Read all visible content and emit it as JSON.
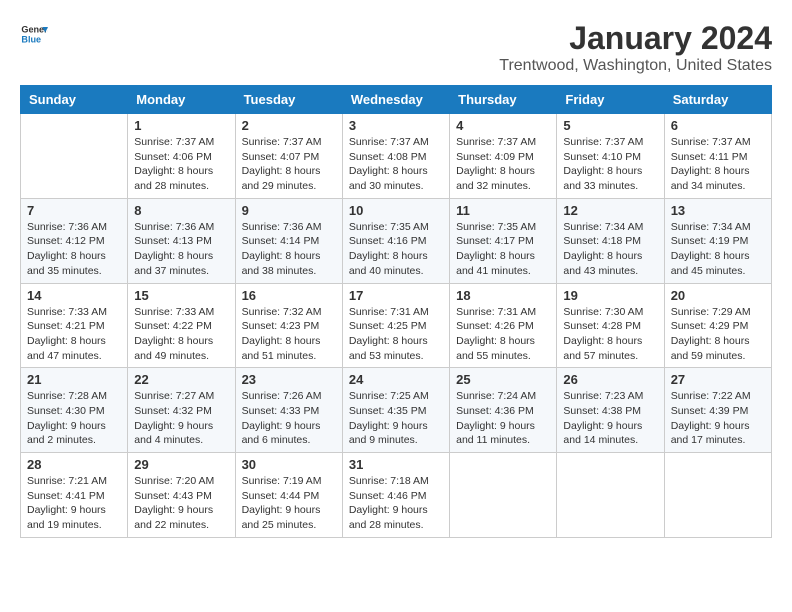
{
  "logo": {
    "general": "General",
    "blue": "Blue"
  },
  "title": "January 2024",
  "location": "Trentwood, Washington, United States",
  "days_of_week": [
    "Sunday",
    "Monday",
    "Tuesday",
    "Wednesday",
    "Thursday",
    "Friday",
    "Saturday"
  ],
  "weeks": [
    [
      {
        "day": "",
        "sunrise": "",
        "sunset": "",
        "daylight": ""
      },
      {
        "day": "1",
        "sunrise": "Sunrise: 7:37 AM",
        "sunset": "Sunset: 4:06 PM",
        "daylight": "Daylight: 8 hours and 28 minutes."
      },
      {
        "day": "2",
        "sunrise": "Sunrise: 7:37 AM",
        "sunset": "Sunset: 4:07 PM",
        "daylight": "Daylight: 8 hours and 29 minutes."
      },
      {
        "day": "3",
        "sunrise": "Sunrise: 7:37 AM",
        "sunset": "Sunset: 4:08 PM",
        "daylight": "Daylight: 8 hours and 30 minutes."
      },
      {
        "day": "4",
        "sunrise": "Sunrise: 7:37 AM",
        "sunset": "Sunset: 4:09 PM",
        "daylight": "Daylight: 8 hours and 32 minutes."
      },
      {
        "day": "5",
        "sunrise": "Sunrise: 7:37 AM",
        "sunset": "Sunset: 4:10 PM",
        "daylight": "Daylight: 8 hours and 33 minutes."
      },
      {
        "day": "6",
        "sunrise": "Sunrise: 7:37 AM",
        "sunset": "Sunset: 4:11 PM",
        "daylight": "Daylight: 8 hours and 34 minutes."
      }
    ],
    [
      {
        "day": "7",
        "sunrise": "Sunrise: 7:36 AM",
        "sunset": "Sunset: 4:12 PM",
        "daylight": "Daylight: 8 hours and 35 minutes."
      },
      {
        "day": "8",
        "sunrise": "Sunrise: 7:36 AM",
        "sunset": "Sunset: 4:13 PM",
        "daylight": "Daylight: 8 hours and 37 minutes."
      },
      {
        "day": "9",
        "sunrise": "Sunrise: 7:36 AM",
        "sunset": "Sunset: 4:14 PM",
        "daylight": "Daylight: 8 hours and 38 minutes."
      },
      {
        "day": "10",
        "sunrise": "Sunrise: 7:35 AM",
        "sunset": "Sunset: 4:16 PM",
        "daylight": "Daylight: 8 hours and 40 minutes."
      },
      {
        "day": "11",
        "sunrise": "Sunrise: 7:35 AM",
        "sunset": "Sunset: 4:17 PM",
        "daylight": "Daylight: 8 hours and 41 minutes."
      },
      {
        "day": "12",
        "sunrise": "Sunrise: 7:34 AM",
        "sunset": "Sunset: 4:18 PM",
        "daylight": "Daylight: 8 hours and 43 minutes."
      },
      {
        "day": "13",
        "sunrise": "Sunrise: 7:34 AM",
        "sunset": "Sunset: 4:19 PM",
        "daylight": "Daylight: 8 hours and 45 minutes."
      }
    ],
    [
      {
        "day": "14",
        "sunrise": "Sunrise: 7:33 AM",
        "sunset": "Sunset: 4:21 PM",
        "daylight": "Daylight: 8 hours and 47 minutes."
      },
      {
        "day": "15",
        "sunrise": "Sunrise: 7:33 AM",
        "sunset": "Sunset: 4:22 PM",
        "daylight": "Daylight: 8 hours and 49 minutes."
      },
      {
        "day": "16",
        "sunrise": "Sunrise: 7:32 AM",
        "sunset": "Sunset: 4:23 PM",
        "daylight": "Daylight: 8 hours and 51 minutes."
      },
      {
        "day": "17",
        "sunrise": "Sunrise: 7:31 AM",
        "sunset": "Sunset: 4:25 PM",
        "daylight": "Daylight: 8 hours and 53 minutes."
      },
      {
        "day": "18",
        "sunrise": "Sunrise: 7:31 AM",
        "sunset": "Sunset: 4:26 PM",
        "daylight": "Daylight: 8 hours and 55 minutes."
      },
      {
        "day": "19",
        "sunrise": "Sunrise: 7:30 AM",
        "sunset": "Sunset: 4:28 PM",
        "daylight": "Daylight: 8 hours and 57 minutes."
      },
      {
        "day": "20",
        "sunrise": "Sunrise: 7:29 AM",
        "sunset": "Sunset: 4:29 PM",
        "daylight": "Daylight: 8 hours and 59 minutes."
      }
    ],
    [
      {
        "day": "21",
        "sunrise": "Sunrise: 7:28 AM",
        "sunset": "Sunset: 4:30 PM",
        "daylight": "Daylight: 9 hours and 2 minutes."
      },
      {
        "day": "22",
        "sunrise": "Sunrise: 7:27 AM",
        "sunset": "Sunset: 4:32 PM",
        "daylight": "Daylight: 9 hours and 4 minutes."
      },
      {
        "day": "23",
        "sunrise": "Sunrise: 7:26 AM",
        "sunset": "Sunset: 4:33 PM",
        "daylight": "Daylight: 9 hours and 6 minutes."
      },
      {
        "day": "24",
        "sunrise": "Sunrise: 7:25 AM",
        "sunset": "Sunset: 4:35 PM",
        "daylight": "Daylight: 9 hours and 9 minutes."
      },
      {
        "day": "25",
        "sunrise": "Sunrise: 7:24 AM",
        "sunset": "Sunset: 4:36 PM",
        "daylight": "Daylight: 9 hours and 11 minutes."
      },
      {
        "day": "26",
        "sunrise": "Sunrise: 7:23 AM",
        "sunset": "Sunset: 4:38 PM",
        "daylight": "Daylight: 9 hours and 14 minutes."
      },
      {
        "day": "27",
        "sunrise": "Sunrise: 7:22 AM",
        "sunset": "Sunset: 4:39 PM",
        "daylight": "Daylight: 9 hours and 17 minutes."
      }
    ],
    [
      {
        "day": "28",
        "sunrise": "Sunrise: 7:21 AM",
        "sunset": "Sunset: 4:41 PM",
        "daylight": "Daylight: 9 hours and 19 minutes."
      },
      {
        "day": "29",
        "sunrise": "Sunrise: 7:20 AM",
        "sunset": "Sunset: 4:43 PM",
        "daylight": "Daylight: 9 hours and 22 minutes."
      },
      {
        "day": "30",
        "sunrise": "Sunrise: 7:19 AM",
        "sunset": "Sunset: 4:44 PM",
        "daylight": "Daylight: 9 hours and 25 minutes."
      },
      {
        "day": "31",
        "sunrise": "Sunrise: 7:18 AM",
        "sunset": "Sunset: 4:46 PM",
        "daylight": "Daylight: 9 hours and 28 minutes."
      },
      {
        "day": "",
        "sunrise": "",
        "sunset": "",
        "daylight": ""
      },
      {
        "day": "",
        "sunrise": "",
        "sunset": "",
        "daylight": ""
      },
      {
        "day": "",
        "sunrise": "",
        "sunset": "",
        "daylight": ""
      }
    ]
  ]
}
